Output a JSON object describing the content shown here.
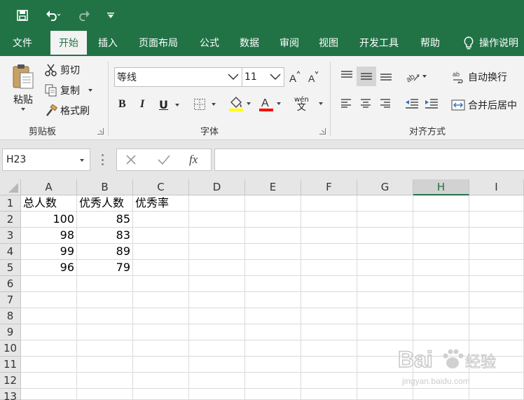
{
  "quick_access": {
    "items": [
      "save-icon",
      "undo-icon",
      "redo-icon",
      "customize-icon"
    ]
  },
  "tabs": [
    {
      "label": "文件"
    },
    {
      "label": "开始"
    },
    {
      "label": "插入"
    },
    {
      "label": "页面布局"
    },
    {
      "label": "公式"
    },
    {
      "label": "数据"
    },
    {
      "label": "审阅"
    },
    {
      "label": "视图"
    },
    {
      "label": "开发工具"
    },
    {
      "label": "帮助"
    }
  ],
  "tell_me": "操作说明",
  "ribbon": {
    "clipboard": {
      "paste": "粘贴",
      "cut": "剪切",
      "copy": "复制",
      "format_painter": "格式刷",
      "label": "剪贴板"
    },
    "font": {
      "name": "等线",
      "size": "11",
      "bold": "B",
      "italic": "I",
      "underline": "U",
      "label": "字体",
      "wen": "wén",
      "wen_char": "文"
    },
    "alignment": {
      "wrap": "自动换行",
      "merge": "合并后居中",
      "label": "对齐方式"
    }
  },
  "formula_bar": {
    "name_box": "H23",
    "fx": "fx",
    "value": ""
  },
  "colors": {
    "accent": "#217346",
    "font_highlight": "#ffff00",
    "font_color": "#ff0000"
  },
  "sheet": {
    "columns": [
      "A",
      "B",
      "C",
      "D",
      "E",
      "F",
      "G",
      "H",
      "I"
    ],
    "selected_column": "H",
    "rows": [
      "1",
      "2",
      "3",
      "4",
      "5",
      "6",
      "7",
      "8",
      "9",
      "10",
      "11",
      "12",
      "13"
    ],
    "cells": [
      [
        "总人数",
        "优秀人数",
        "优秀率"
      ],
      [
        "100",
        "85",
        ""
      ],
      [
        "98",
        "83",
        ""
      ],
      [
        "99",
        "89",
        ""
      ],
      [
        "96",
        "79",
        ""
      ]
    ]
  },
  "watermark": {
    "text": "Bai 经验",
    "url": "jingyan.baidu.com"
  }
}
